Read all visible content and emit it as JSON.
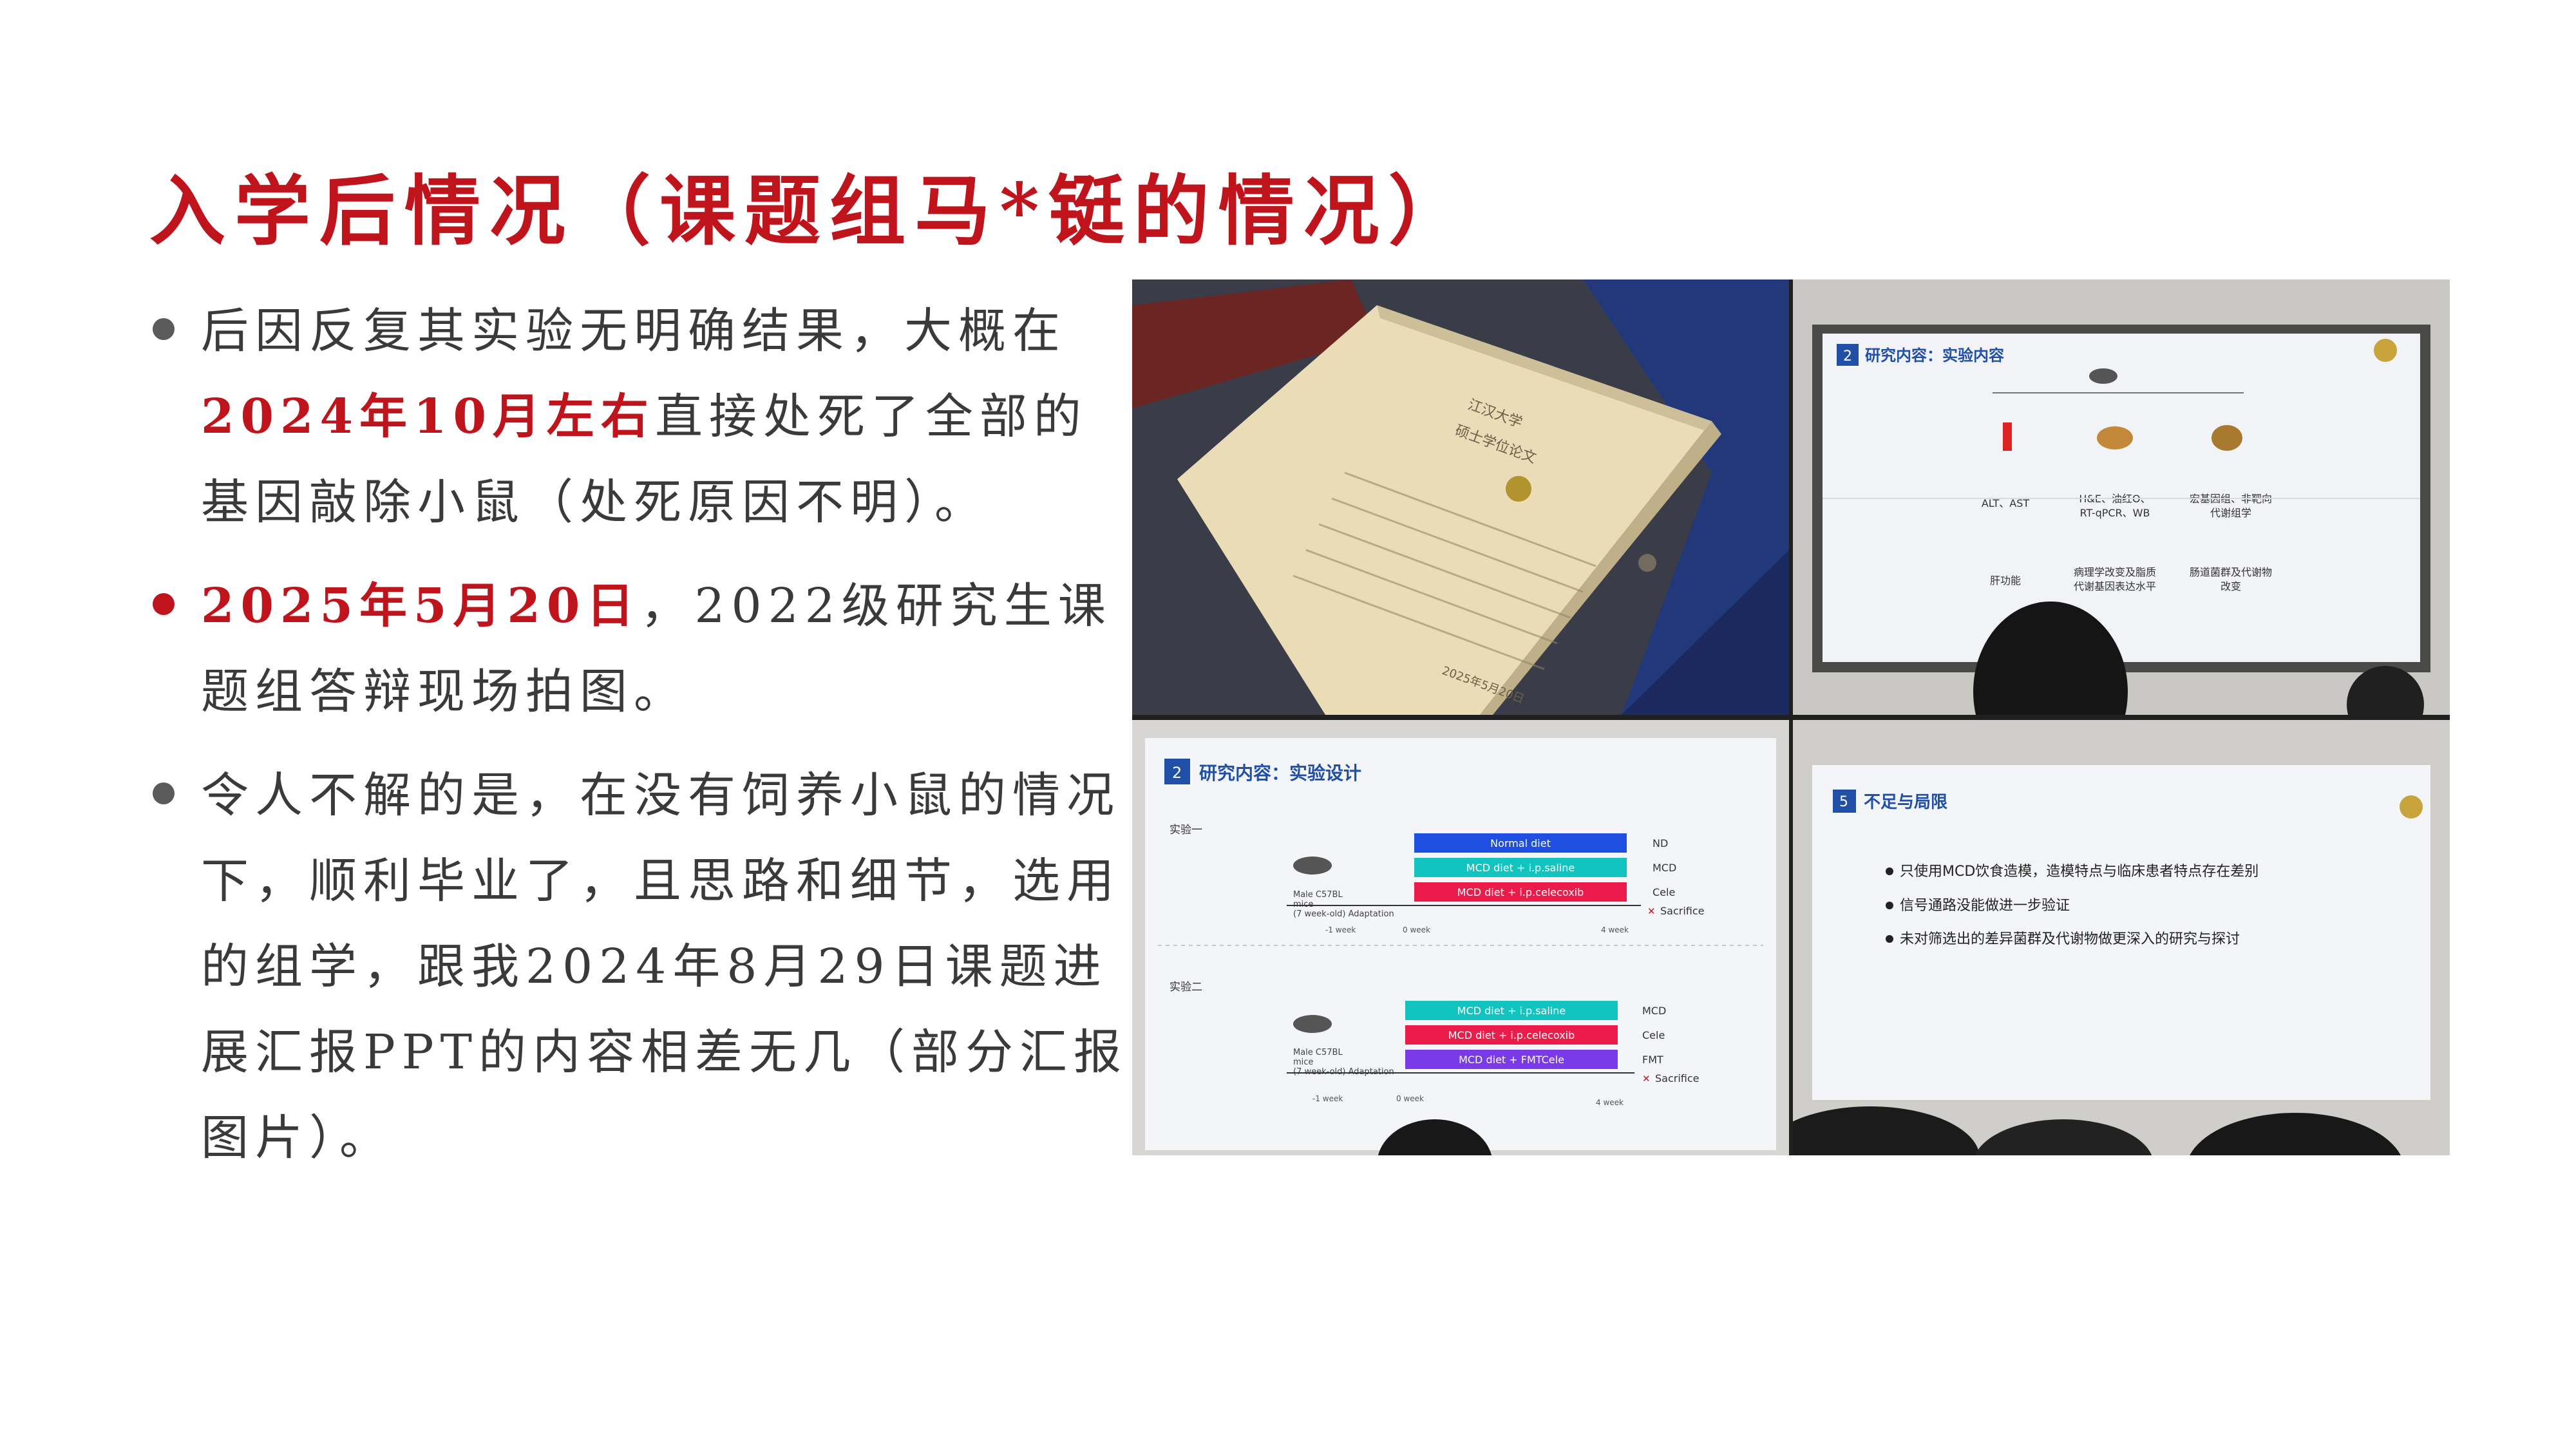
{
  "title": "入学后情况（课题组马*铤的情况）",
  "bullets": [
    {
      "parts": [
        {
          "text": "后因反复其实验无明确结果，大概在",
          "highlight": false
        },
        {
          "text": "2024年10月左右",
          "highlight": true
        },
        {
          "text": "直接处死了全部的基因敲除小鼠（处死原因不明）。",
          "highlight": false
        }
      ],
      "dot": "gray"
    },
    {
      "parts": [
        {
          "text": "2025年5月20日",
          "highlight": true
        },
        {
          "text": "，2022级研究生课题组答辩现场拍图。",
          "highlight": false
        }
      ],
      "dot": "red"
    },
    {
      "parts": [
        {
          "text": "令人不解的是，在没有饲养小鼠的情况下，顺利毕业了，且思路和细节，选用的组学，跟我2024年8月29日课题进展汇报PPT的内容相差无几（部分汇报图片）。",
          "highlight": false
        }
      ],
      "dot": "gray"
    }
  ],
  "photos": {
    "thesis": {
      "line1": "江汉大学",
      "line2": "硕士学位论文",
      "date": "2025年5月20日"
    },
    "slide1": {
      "num": "2",
      "heading": "研究内容：实验内容",
      "col1": [
        "ALT、AST",
        "肝功能"
      ],
      "col2": [
        "H&E、油红O、",
        "RT-qPCR、WB",
        "病理学改变及脂质",
        "代谢基因表达水平"
      ],
      "col3": [
        "宏基因组、非靶向",
        "代谢组学",
        "肠道菌群及代谢物",
        "改变"
      ]
    },
    "slide2": {
      "num": "2",
      "heading": "研究内容：实验设计",
      "exp1": "实验一",
      "exp2": "实验二",
      "mice": [
        "Male C57BL",
        "mice",
        "(7 week-old) Adaptation"
      ],
      "bars1": [
        "Normal diet",
        "MCD diet + i.p.saline",
        "MCD diet + i.p.celecoxib"
      ],
      "labels1": [
        "ND",
        "MCD",
        "Cele",
        "Sacrifice"
      ],
      "bars2": [
        "MCD diet + i.p.saline",
        "MCD diet + i.p.celecoxib",
        "MCD diet + FMTCele"
      ],
      "labels2": [
        "MCD",
        "Cele",
        "FMT",
        "Sacrifice"
      ],
      "ticks": [
        "-1 week",
        "0 week",
        "4 week"
      ]
    },
    "slide3": {
      "num": "5",
      "heading": "不足与局限",
      "items": [
        "只使用MCD饮食造模，造模特点与临床患者特点存在差别",
        "信号通路没能做进一步验证",
        "未对筛选出的差异菌群及代谢物做更深入的研究与探讨"
      ]
    }
  },
  "colors": {
    "accent": "#c0141c",
    "text": "#3a3a3a",
    "slide_blue": "#1f4fa6",
    "bar_blue": "#1e4fe0",
    "bar_teal": "#12c4c0",
    "bar_red": "#ec1c4a",
    "bar_purple": "#7a3ae8"
  }
}
